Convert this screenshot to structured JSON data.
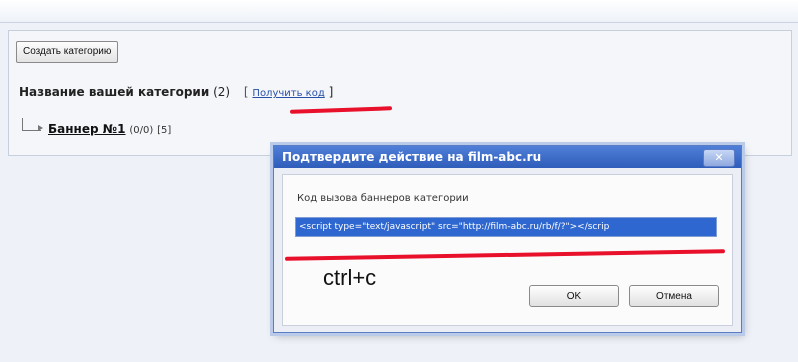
{
  "toolbar": {
    "create_category_label": "Создать категорию"
  },
  "category": {
    "name": "Название вашей категории",
    "count": "(2)",
    "bracket_open": "[",
    "get_code_link": "Получить код",
    "bracket_close": "]"
  },
  "banner": {
    "name": "Баннер №1",
    "stats": "(0/0)",
    "count": "[5]"
  },
  "dialog": {
    "title": "Подтвердите действие на film-abc.ru",
    "close_label": "✕",
    "prompt": "Код вызова баннеров категории",
    "code_value": "<script type=\"text/javascript\" src=\"http://film-abc.ru/rb/f/?\"></scrip",
    "hint": "ctrl+c",
    "ok_label": "OK",
    "cancel_label": "Отмена"
  },
  "colors": {
    "annotation": "#e8102a",
    "title_bar": "#2f5dba",
    "selection": "#2e67cf"
  }
}
